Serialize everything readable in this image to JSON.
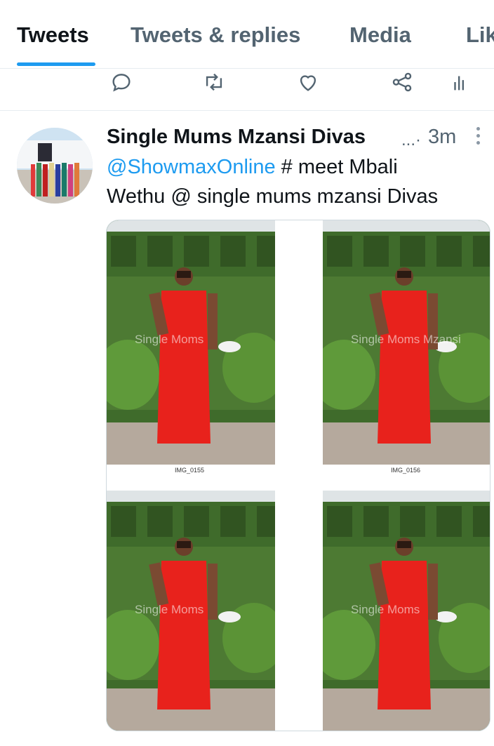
{
  "tabs": [
    {
      "label": "Tweets",
      "active": true
    },
    {
      "label": "Tweets & replies",
      "active": false
    },
    {
      "label": "Media",
      "active": false
    },
    {
      "label": "Lik",
      "active": false
    }
  ],
  "prev_tweet_actions": [
    "reply-icon",
    "retweet-icon",
    "like-icon",
    "share-icon",
    "analytics-icon"
  ],
  "tweet": {
    "author_name": "Single Mums Mzansi Divas",
    "name_truncation": "...·",
    "time": "3m",
    "mention": "@ShowmaxOnline",
    "text_rest_line1": " # meet Mbali",
    "text_line2": "Wethu @ single mums mzansi Divas",
    "media": [
      {
        "caption": "IMG_0155",
        "watermark": "Single Moms"
      },
      {
        "caption": "IMG_0156",
        "watermark": "Single Moms Mzansi"
      },
      {
        "caption": "",
        "watermark": "Single Moms"
      },
      {
        "caption": "",
        "watermark": "Single Moms"
      }
    ]
  },
  "colors": {
    "accent": "#1d9bf0",
    "dress": "#e8221c",
    "hedge": "#3f6b2b"
  }
}
